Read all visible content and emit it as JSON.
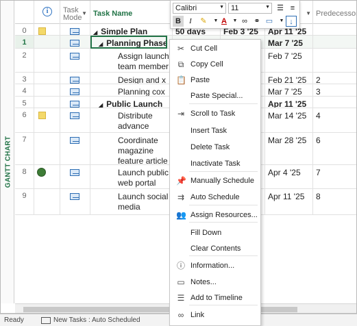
{
  "side_label": "GANTT CHART",
  "columns": {
    "info_icon": "i",
    "task_mode": "Task Mode",
    "task_name": "Task Name",
    "predecessors": "Predecessors",
    "dropdown_arrow": "▼"
  },
  "rows": [
    {
      "num": "0",
      "indicator": "note",
      "name": "Simple Plan",
      "bold": true,
      "level": 0,
      "duration": "50 days",
      "start": "Feb 3 '25",
      "finish": "Apr 11 '25",
      "pred": ""
    },
    {
      "num": "1",
      "indicator": "",
      "name": "Planning Phase",
      "bold": true,
      "level": 1,
      "duration": "",
      "start": "",
      "finish": "Mar 7 '25",
      "pred": ""
    },
    {
      "num": "2",
      "indicator": "",
      "name": "Assign launch team member",
      "bold": false,
      "level": 2,
      "duration": "",
      "start": "",
      "finish": "Feb 7 '25",
      "pred": ""
    },
    {
      "num": "3",
      "indicator": "",
      "name": "Design and x o",
      "bold": false,
      "level": 2,
      "duration": "",
      "start": "",
      "finish": "Feb 21 '25",
      "pred": "2"
    },
    {
      "num": "4",
      "indicator": "",
      "name": "Planning cox",
      "bold": false,
      "level": 2,
      "duration": "",
      "start": "",
      "finish": "Mar 7 '25",
      "pred": "3"
    },
    {
      "num": "5",
      "indicator": "",
      "name": "Public Launch",
      "bold": true,
      "level": 1,
      "duration": "",
      "start": "",
      "finish": "Apr 11 '25",
      "pred": ""
    },
    {
      "num": "6",
      "indicator": "note",
      "name": "Distribute advance copie",
      "bold": false,
      "level": 2,
      "duration": "",
      "start": "",
      "finish": "Mar 14 '25",
      "pred": "4"
    },
    {
      "num": "7",
      "indicator": "",
      "name": "Coordinate magazine feature article",
      "bold": false,
      "level": 2,
      "duration": "",
      "start": "",
      "finish": "Mar 28 '25",
      "pred": "6"
    },
    {
      "num": "8",
      "indicator": "globe",
      "name": "Launch public web portal",
      "bold": false,
      "level": 2,
      "duration": "",
      "start": "",
      "finish": "Apr 4 '25",
      "pred": "7"
    },
    {
      "num": "9",
      "indicator": "",
      "name": "Launch social media",
      "bold": false,
      "level": 2,
      "duration": "",
      "start": "",
      "finish": "Apr 11 '25",
      "pred": "8"
    }
  ],
  "mini_toolbar": {
    "font": "Calibri",
    "size": "11",
    "bold": "B",
    "italic": "I",
    "font_color_letter": "A"
  },
  "context_menu": [
    {
      "label": "Cut Cell",
      "icon": "scissors-icon",
      "glyph": "✂"
    },
    {
      "label": "Copy Cell",
      "icon": "copy-icon",
      "glyph": "⧉"
    },
    {
      "label": "Paste",
      "icon": "paste-icon",
      "glyph": "📋"
    },
    {
      "label": "Paste Special...",
      "icon": "",
      "glyph": ""
    },
    {
      "label": "Scroll to Task",
      "icon": "scroll-to-task-icon",
      "glyph": "⇥"
    },
    {
      "label": "Insert Task",
      "icon": "",
      "glyph": ""
    },
    {
      "label": "Delete Task",
      "icon": "",
      "glyph": ""
    },
    {
      "label": "Inactivate Task",
      "icon": "",
      "glyph": ""
    },
    {
      "label": "Manually Schedule",
      "icon": "pin-icon",
      "glyph": "📌"
    },
    {
      "label": "Auto Schedule",
      "icon": "auto-schedule-icon",
      "glyph": "⇉"
    },
    {
      "label": "Assign Resources...",
      "icon": "resources-icon",
      "glyph": "👥"
    },
    {
      "label": "Fill Down",
      "icon": "",
      "glyph": ""
    },
    {
      "label": "Clear Contents",
      "icon": "",
      "glyph": ""
    },
    {
      "label": "Information...",
      "icon": "information-icon",
      "glyph": "ⓘ"
    },
    {
      "label": "Notes...",
      "icon": "notes-icon",
      "glyph": "▭"
    },
    {
      "label": "Add to Timeline",
      "icon": "timeline-icon",
      "glyph": "☰"
    },
    {
      "label": "Link",
      "icon": "link-icon",
      "glyph": "∞"
    }
  ],
  "status": {
    "ready": "Ready",
    "new_tasks": "New Tasks : Auto Scheduled"
  }
}
